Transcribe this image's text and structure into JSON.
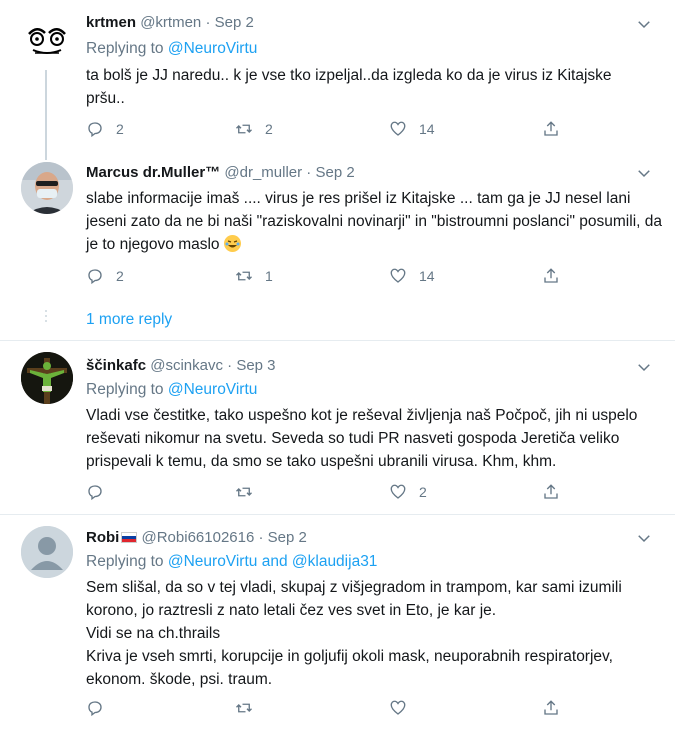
{
  "tweets": [
    {
      "name": "krtmen",
      "handle": "@krtmen",
      "date": "Sep 2",
      "replying_prefix": "Replying to ",
      "replying_to": "@NeuroVirtu",
      "text": "ta bolš je JJ naredu.. k je vse tko izpeljal..da izgleda ko da je virus iz Kitajske pršu..",
      "replies": "2",
      "retweets": "2",
      "likes": "14"
    },
    {
      "name": "Marcus dr.Muller™",
      "handle": "@dr_muller",
      "date": "Sep 2",
      "text": "slabe informacije imaš .... virus je res prišel iz Kitajske ... tam ga je JJ nesel lani jeseni zato da ne bi naši \"raziskovalni novinarji\" in \"bistroumni poslanci\" posumili, da je to njegovo maslo",
      "emoji": "rolling-on-floor-laughing",
      "replies": "2",
      "retweets": "1",
      "likes": "14"
    },
    {
      "name": "ščinkafc",
      "handle": "@scinkavc",
      "date": "Sep 3",
      "replying_prefix": "Replying to ",
      "replying_to": "@NeuroVirtu",
      "text": "Vladi vse čestitke, tako uspešno kot je reševal življenja naš Počpoč, jih ni uspelo reševati nikomur na svetu. Seveda so tudi PR nasveti gospoda Jeretiča veliko prispevali k temu, da smo se tako uspešni ubranili virusa. Khm, khm.",
      "replies": "",
      "retweets": "",
      "likes": "2"
    },
    {
      "name": "Robi",
      "handle": "@Robi66102616",
      "date": "Sep 2",
      "replying_prefix": "Replying to ",
      "replying_to": "@NeuroVirtu",
      "replying_and": " and ",
      "replying_to2": "@klaudija31",
      "line1": "Sem slišal, da so v tej vladi, skupaj z višjegradom in trampom, kar sami izumili korono, jo raztresli z nato letali čez ves svet in Eto, je kar je.",
      "line2": "Vidi se na ch.thrails",
      "line3": "Kriva je vseh smrti, korupcije in goljufij okoli mask, neuporabnih respiratorjev, ekonom. škode, psi. traum.",
      "replies": "",
      "retweets": "",
      "likes": ""
    }
  ],
  "more_reply": "1 more reply",
  "separator_dot": "·",
  "colors": {
    "accent": "#1da1f2",
    "muted": "#657786",
    "text": "#14171a",
    "border": "#e6ecf0",
    "thread": "#ccd6dd"
  }
}
